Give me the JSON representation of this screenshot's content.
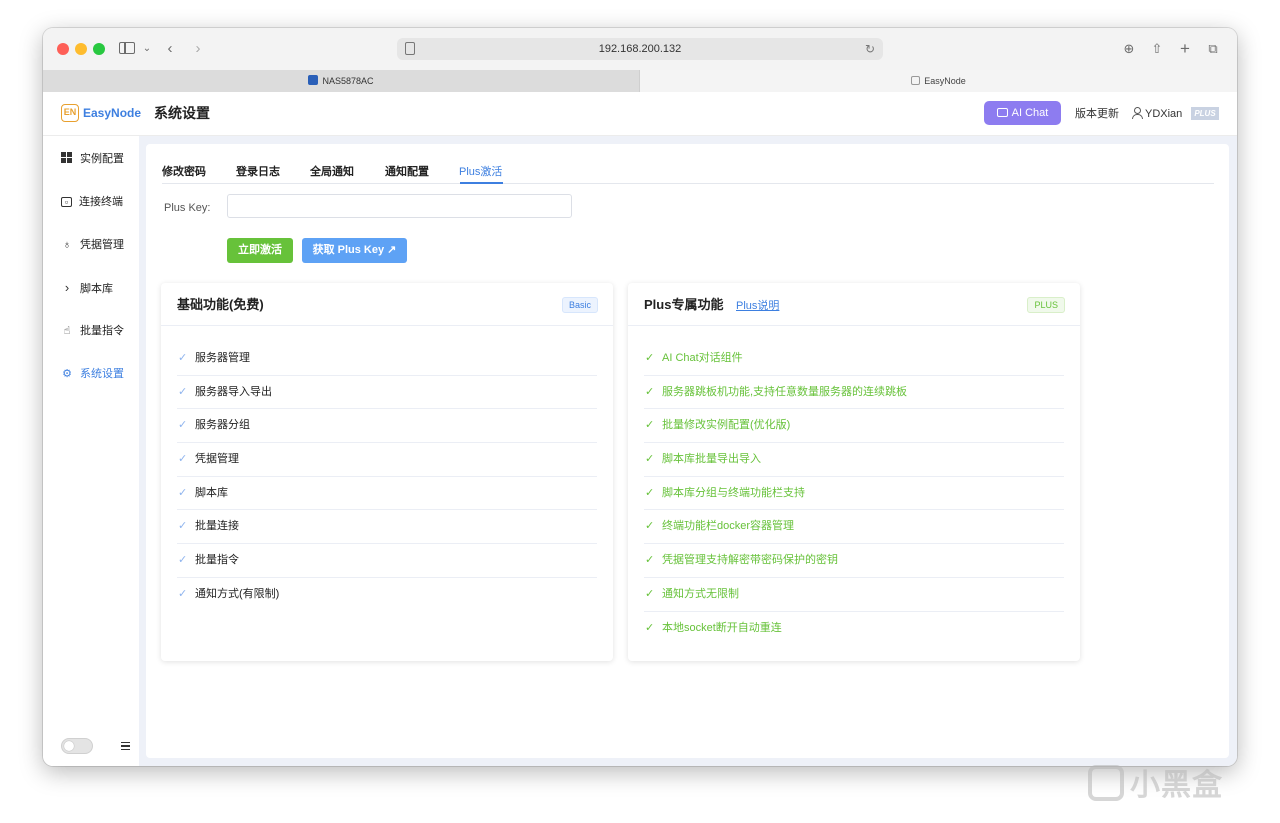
{
  "browser": {
    "url": "192.168.200.132",
    "tabs": [
      {
        "label": "NAS5878AC"
      },
      {
        "label": "EasyNode"
      }
    ]
  },
  "header": {
    "logo_mark": "EN",
    "logo_text": "EasyNode",
    "page_title": "系统设置",
    "ai_chat_label": "AI Chat",
    "update_label": "版本更新",
    "user_name": "YDXian",
    "plus_badge": "PLUS"
  },
  "sidebar": {
    "items": [
      {
        "label": "实例配置",
        "icon": "grid-icon"
      },
      {
        "label": "连接终端",
        "icon": "terminal-icon"
      },
      {
        "label": "凭据管理",
        "icon": "key-icon"
      },
      {
        "label": "脚本库",
        "icon": "chevron-right-icon"
      },
      {
        "label": "批量指令",
        "icon": "pointer-icon"
      },
      {
        "label": "系统设置",
        "icon": "gear-icon"
      }
    ],
    "active_index": 5
  },
  "settings": {
    "tabs": [
      "修改密码",
      "登录日志",
      "全局通知",
      "通知配置",
      "Plus激活"
    ],
    "active_tab": 4,
    "plus_key_label": "Plus Key:",
    "plus_key_value": "",
    "activate_label": "立即激活",
    "get_key_label": "获取 Plus Key ↗"
  },
  "basic_features": {
    "title": "基础功能(免费)",
    "tag": "Basic",
    "items": [
      "服务器管理",
      "服务器导入导出",
      "服务器分组",
      "凭据管理",
      "脚本库",
      "批量连接",
      "批量指令",
      "通知方式(有限制)"
    ]
  },
  "plus_features": {
    "title": "Plus专属功能",
    "link": "Plus说明",
    "tag": "PLUS",
    "items": [
      "AI Chat对话组件",
      "服务器跳板机功能,支持任意数量服务器的连续跳板",
      "批量修改实例配置(优化版)",
      "脚本库批量导出导入",
      "脚本库分组与终端功能栏支持",
      "终端功能栏docker容器管理",
      "凭据管理支持解密带密码保护的密钥",
      "通知方式无限制",
      "本地socket断开自动重连"
    ]
  },
  "watermark": "小黑盒",
  "colors": {
    "accent": "#3d7fe0",
    "success": "#67c23a",
    "ai_chat": "#8d7cf0",
    "main_bg": "#eef1f8"
  }
}
